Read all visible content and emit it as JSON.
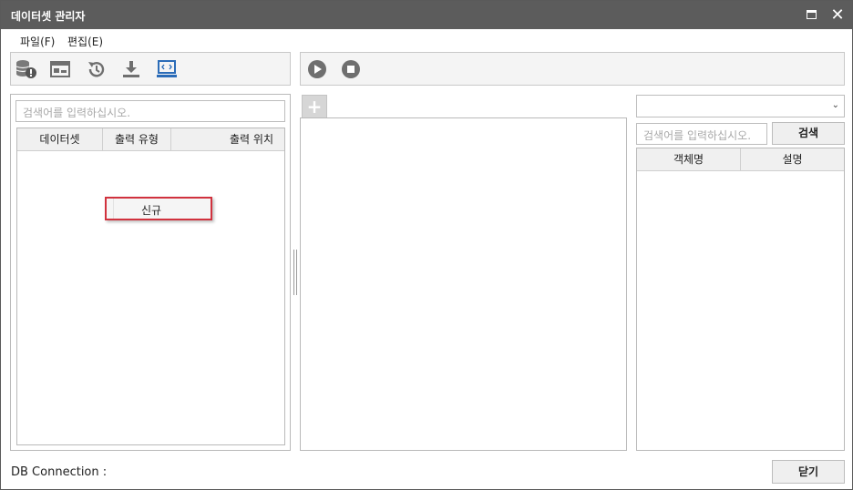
{
  "window": {
    "title": "데이터셋 관리자",
    "close_symbol": "✕"
  },
  "menu": {
    "items": [
      {
        "label": "파일(F)"
      },
      {
        "label": "편집(E)"
      }
    ]
  },
  "toolbar": {
    "left_icons": [
      "database-warning-icon",
      "window-layout-icon",
      "history-icon",
      "download-icon",
      "code-screen-icon"
    ],
    "right_icons": [
      "play-icon",
      "stop-icon"
    ]
  },
  "left_panel": {
    "search_placeholder": "검색어를 입력하십시오.",
    "columns": [
      "데이터셋",
      "출력 유형",
      "출력 위치"
    ],
    "rows": []
  },
  "context_menu": {
    "items": [
      {
        "label": "신규"
      }
    ]
  },
  "center_panel": {
    "add_tab_symbol": "+"
  },
  "right_panel": {
    "combo_value": "",
    "search_placeholder": "검색어를 입력하십시오.",
    "search_button": "검색",
    "columns": [
      "객체명",
      "설명"
    ],
    "rows": []
  },
  "footer": {
    "status_label": "DB Connection :",
    "close_button": "닫기"
  },
  "colors": {
    "titlebar": "#5c5c5c",
    "context_menu_border": "#d1323e",
    "icon_gray": "#777777",
    "icon_blue": "#2b6cb8"
  }
}
